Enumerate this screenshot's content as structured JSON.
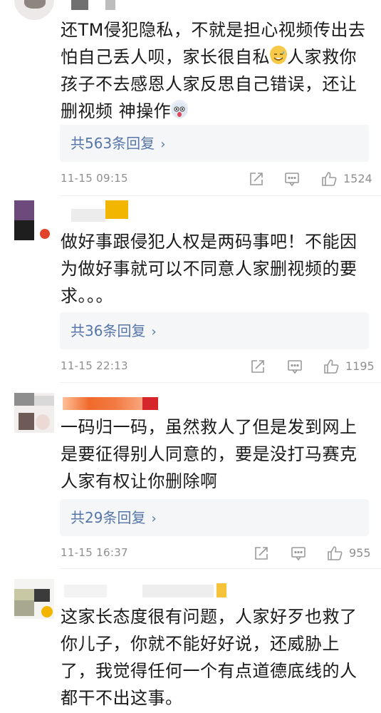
{
  "comments": [
    {
      "text": "还TM侵犯隐私，不就是担心视频传出去怕自己丢人呗，家长很自私",
      "text_after_emoji": "人家救你孩子不去感恩人家反思自己错误，还让删视频 神操作",
      "reply_label": "共563条回复",
      "time": "11-15 09:15",
      "likes": "1524"
    },
    {
      "text": "做好事跟侵犯人权是两码事吧！不能因为做好事就可以不同意人家删视频的要求。。。",
      "reply_label": "共36条回复",
      "time": "11-15 22:13",
      "likes": "1195"
    },
    {
      "text": "一码归一码，虽然救人了但是发到网上是要征得别人同意的，要是没打马赛克人家有权让你删除啊",
      "reply_label": "共29条回复",
      "time": "11-15 16:37",
      "likes": "955"
    },
    {
      "text": "这家长态度很有问题，人家好歹也救了你儿子，你就不能好好说，还威胁上了，我觉得任何一个有点道德底线的人都干不出这事。"
    }
  ],
  "icons": {
    "share": "share-icon",
    "comment": "comment-icon",
    "like": "thumbs-up-icon",
    "chevron": "chevron-right-icon"
  },
  "colors": {
    "link": "#5675a8",
    "meta": "#8f8f8f",
    "reply_bg": "#f5f6f8"
  }
}
